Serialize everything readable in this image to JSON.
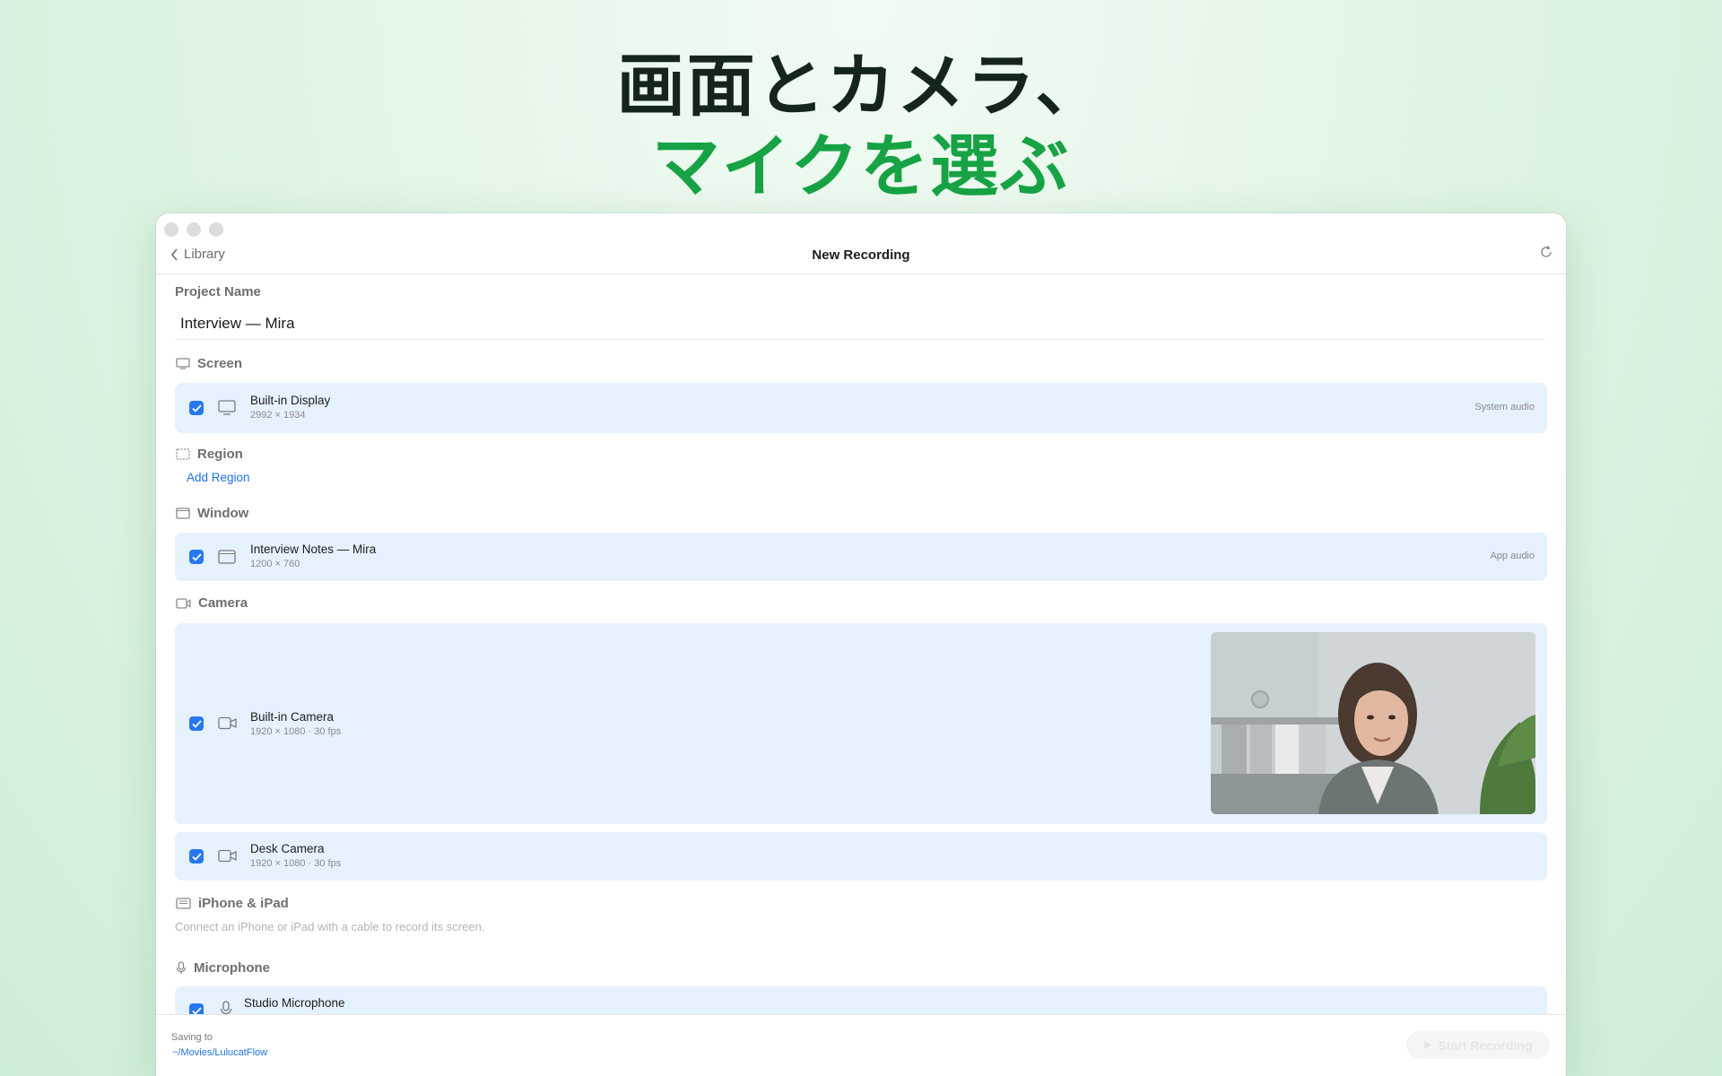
{
  "headline": {
    "line1": "画面とカメラ、",
    "line2": "マイクを選ぶ"
  },
  "window": {
    "back_label": "Library",
    "title": "New Recording"
  },
  "project": {
    "label": "Project Name",
    "value": "Interview — Mira"
  },
  "screen": {
    "label": "Screen",
    "items": [
      {
        "name": "Built-in Display",
        "detail": "2992 × 1934",
        "audio": "System audio",
        "checked": true
      }
    ]
  },
  "region": {
    "label": "Region",
    "add_label": "Add Region"
  },
  "window_section": {
    "label": "Window",
    "items": [
      {
        "name": "Interview Notes — Mira",
        "detail": "1200 × 760",
        "audio": "App audio",
        "checked": true
      }
    ]
  },
  "camera": {
    "label": "Camera",
    "items": [
      {
        "name": "Built-in Camera",
        "detail": "1920 × 1080 · 30 fps",
        "checked": true
      },
      {
        "name": "Desk Camera",
        "detail": "1920 × 1080 · 30 fps",
        "checked": true
      }
    ]
  },
  "iphone": {
    "label": "iPhone & iPad",
    "hint": "Connect an iPhone or iPad with a cable to record its screen."
  },
  "microphone": {
    "label": "Microphone",
    "items": [
      {
        "name": "Studio Microphone",
        "checked": true
      }
    ]
  },
  "footer": {
    "saving_label": "Saving to",
    "path": "~/Movies/LulucatFlow",
    "start_label": "Start Recording"
  },
  "colors": {
    "accent": "#2678f0",
    "row_bg": "#e6f1fe",
    "headline_green": "#17a345"
  }
}
